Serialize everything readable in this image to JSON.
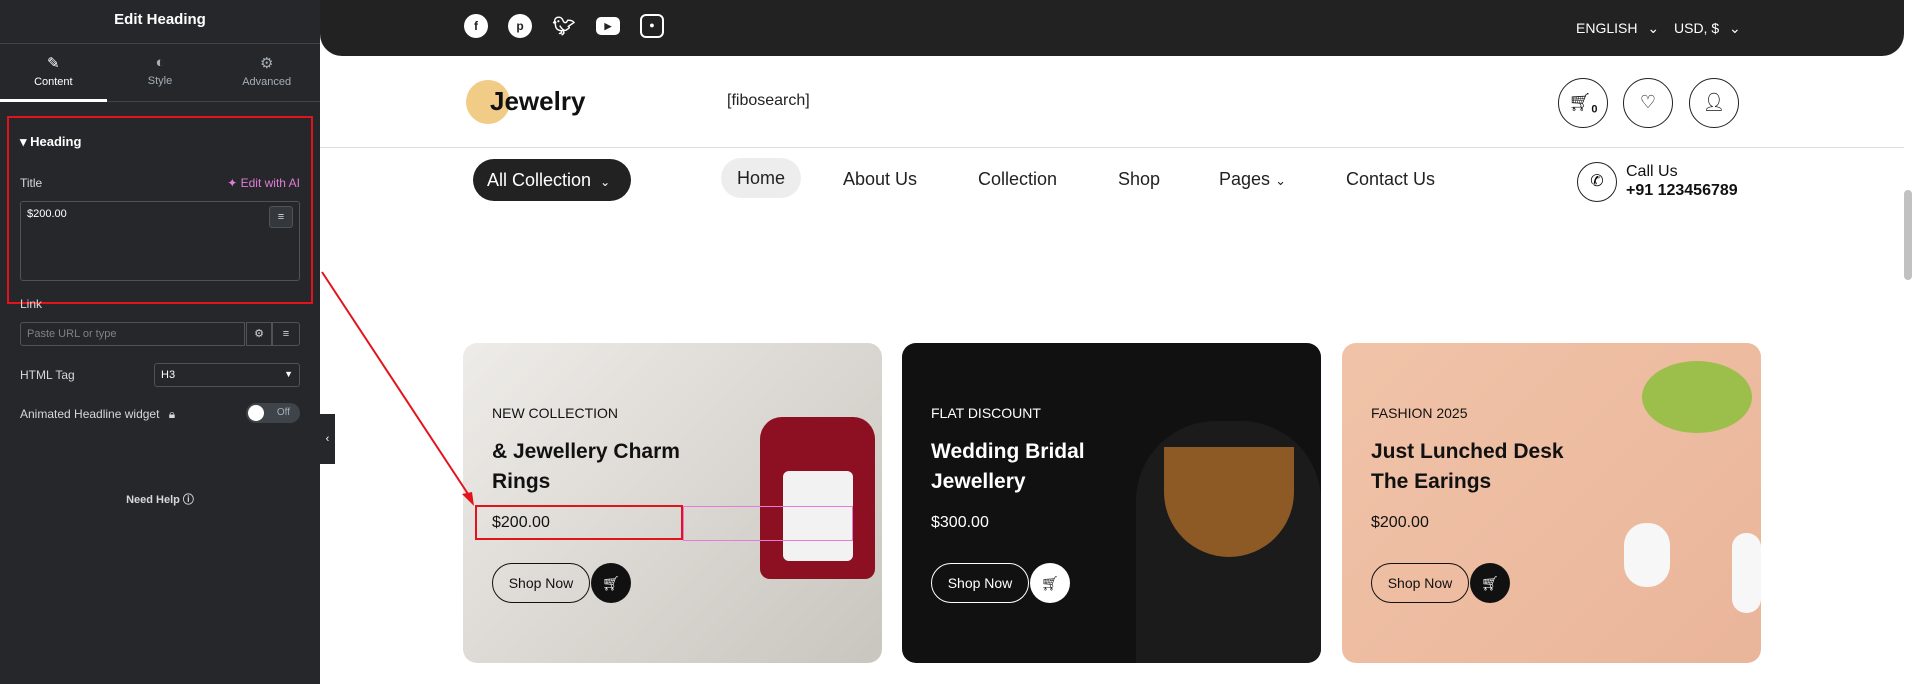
{
  "panel": {
    "header": "Edit Heading",
    "tabs": [
      {
        "label": "Content",
        "icon": "pencil-icon"
      },
      {
        "label": "Style",
        "icon": "half-circle-icon"
      },
      {
        "label": "Advanced",
        "icon": "gear-icon"
      }
    ],
    "section_title": "Heading",
    "title_label": "Title",
    "edit_ai_label": "Edit with AI",
    "title_value": "$200.00",
    "link_label": "Link",
    "link_placeholder": "Paste URL or type",
    "html_tag_label": "HTML Tag",
    "html_tag_value": "H3",
    "animated_label": "Animated Headline widget",
    "toggle_label": "Off",
    "need_help": "Need Help"
  },
  "topbar": {
    "social": [
      "facebook-icon",
      "pinterest-icon",
      "twitter-icon",
      "youtube-icon",
      "instagram-icon"
    ],
    "language": "ENGLISH",
    "currency": "USD, $"
  },
  "header": {
    "logo": "Jewelry",
    "search_shortcode": "[fibosearch]",
    "cart_count": "0"
  },
  "nav": {
    "all_collection": "All Collection",
    "items": [
      "Home",
      "About Us",
      "Collection",
      "Shop",
      "Pages",
      "Contact Us"
    ],
    "call_label": "Call Us",
    "phone": "+91 123456789"
  },
  "cards": [
    {
      "tag": "NEW COLLECTION",
      "title": "& Jewellery Charm Rings",
      "price": "$200.00",
      "button": "Shop Now"
    },
    {
      "tag": "FLAT DISCOUNT",
      "title": "Wedding Bridal Jewellery",
      "price": "$300.00",
      "button": "Shop Now"
    },
    {
      "tag": "FASHION 2025",
      "title": "Just Lunched Desk The Earings",
      "price": "$200.00",
      "button": "Shop Now"
    }
  ],
  "colors": {
    "annotation": "#e3131b",
    "panel_bg": "#26272b",
    "topbar_bg": "#222222"
  }
}
